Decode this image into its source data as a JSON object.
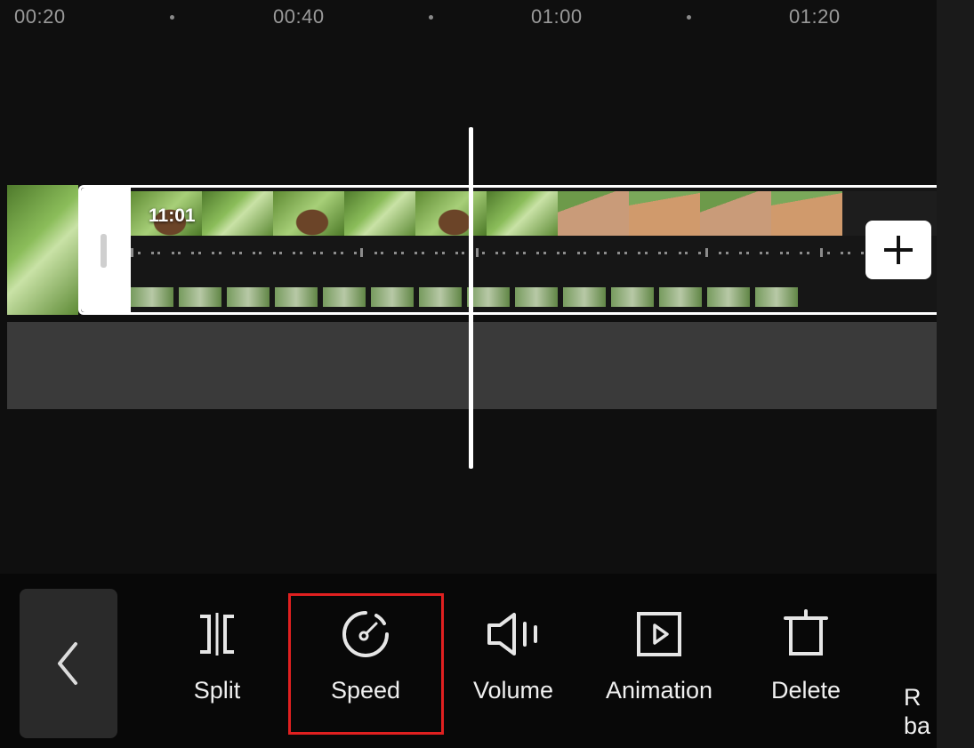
{
  "ruler": {
    "ticks": [
      "00:20",
      "00:40",
      "01:00",
      "01:20"
    ]
  },
  "timeline": {
    "clip_duration": "11:01",
    "add_button_label": "+"
  },
  "toolbar": {
    "back_label": "<",
    "tools": [
      {
        "label": "Split",
        "icon": "split-icon"
      },
      {
        "label": "Speed",
        "icon": "speed-gauge-icon",
        "highlighted": true
      },
      {
        "label": "Volume",
        "icon": "volume-icon"
      },
      {
        "label": "Animation",
        "icon": "animation-play-icon"
      },
      {
        "label": "Delete",
        "icon": "trash-icon"
      }
    ],
    "partial_tool_label_line1": "R",
    "partial_tool_label_line2": "ba"
  },
  "colors": {
    "background": "#0f0f0f",
    "highlight": "#e02020",
    "playhead": "#ffffff",
    "audio_lane": "#3a3a3a"
  }
}
